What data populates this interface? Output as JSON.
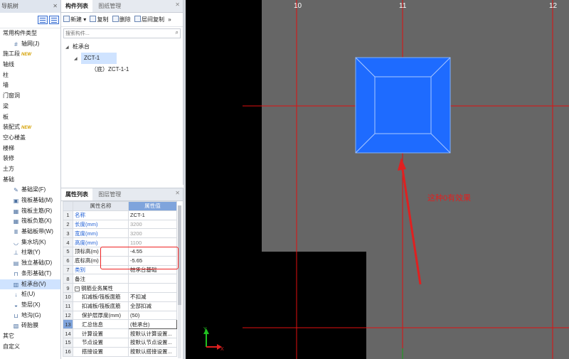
{
  "nav": {
    "title": "导航树",
    "items": [
      {
        "label": "常用构件类型",
        "type": "top"
      },
      {
        "label": "轴网(J)",
        "type": "sub",
        "icon": "grid-icon"
      },
      {
        "label": "施工段",
        "type": "top",
        "badge": "NEW"
      },
      {
        "label": "轴线",
        "type": "top"
      },
      {
        "label": "柱",
        "type": "top"
      },
      {
        "label": "墙",
        "type": "top"
      },
      {
        "label": "门窗洞",
        "type": "top"
      },
      {
        "label": "梁",
        "type": "top"
      },
      {
        "label": "板",
        "type": "top"
      },
      {
        "label": "装配式",
        "type": "top",
        "badge": "NEW"
      },
      {
        "label": "空心楼盖",
        "type": "top"
      },
      {
        "label": "楼梯",
        "type": "top"
      },
      {
        "label": "装修",
        "type": "top"
      },
      {
        "label": "土方",
        "type": "top"
      },
      {
        "label": "基础",
        "type": "top"
      },
      {
        "label": "基础梁(F)",
        "type": "sub",
        "icon": "pencil-icon"
      },
      {
        "label": "筏板基础(M)",
        "type": "sub",
        "icon": "slab-icon"
      },
      {
        "label": "筏板主筋(R)",
        "type": "sub",
        "icon": "rebar-icon"
      },
      {
        "label": "筏板负筋(X)",
        "type": "sub",
        "icon": "rebar-icon"
      },
      {
        "label": "基础板带(W)",
        "type": "sub",
        "icon": "strip-icon"
      },
      {
        "label": "集水坑(K)",
        "type": "sub",
        "icon": "pit-icon"
      },
      {
        "label": "柱墩(Y)",
        "type": "sub",
        "icon": "pier-icon"
      },
      {
        "label": "独立基础(D)",
        "type": "sub",
        "icon": "footing-icon"
      },
      {
        "label": "条形基础(T)",
        "type": "sub",
        "icon": "strip-footing-icon"
      },
      {
        "label": "桩承台(V)",
        "type": "sub",
        "icon": "pile-cap-icon",
        "selected": true
      },
      {
        "label": "桩(U)",
        "type": "sub",
        "icon": "pile-icon"
      },
      {
        "label": "垫层(X)",
        "type": "sub",
        "icon": "cushion-icon"
      },
      {
        "label": "地沟(G)",
        "type": "sub",
        "icon": "trench-icon"
      },
      {
        "label": "砖胎膜",
        "type": "sub",
        "icon": "brick-icon"
      },
      {
        "label": "其它",
        "type": "top"
      },
      {
        "label": "自定义",
        "type": "top"
      }
    ]
  },
  "comp_panel": {
    "tabs": [
      "构件列表",
      "图纸管理"
    ],
    "toolbar": {
      "new": "新建",
      "copy": "复制",
      "delete": "删除",
      "floor_copy": "层间复制"
    },
    "search_placeholder": "搜索构件...",
    "tree": {
      "root": "桩承台",
      "child": "ZCT-1",
      "leaf": "（底）ZCT-1-1"
    }
  },
  "prop_panel": {
    "tabs": [
      "属性列表",
      "图层管理"
    ],
    "headers": {
      "name": "属性名称",
      "value": "属性值"
    },
    "rows": [
      {
        "n": "1",
        "name": "名称",
        "value": "ZCT-1",
        "style": "blue"
      },
      {
        "n": "2",
        "name": "长度(mm)",
        "value": "3200",
        "style": "blue-gray"
      },
      {
        "n": "3",
        "name": "宽度(mm)",
        "value": "3200",
        "style": "blue-gray"
      },
      {
        "n": "4",
        "name": "高度(mm)",
        "value": "1100",
        "style": "blue-gray"
      },
      {
        "n": "5",
        "name": "顶标高(m)",
        "value": "-4.55",
        "style": ""
      },
      {
        "n": "6",
        "name": "底标高(m)",
        "value": "-5.65",
        "style": ""
      },
      {
        "n": "7",
        "name": "类别",
        "value": "桩承台基础",
        "style": "blue"
      },
      {
        "n": "8",
        "name": "备注",
        "value": "",
        "style": ""
      },
      {
        "n": "9",
        "name": "钢筋业务属性",
        "value": "",
        "style": "group"
      },
      {
        "n": "10",
        "name": "扣减板/筏板面筋",
        "value": "不扣减",
        "style": "indent"
      },
      {
        "n": "11",
        "name": "扣减板/筏板底筋",
        "value": "全部扣减",
        "style": "indent"
      },
      {
        "n": "12",
        "name": "保护层厚度(mm)",
        "value": "(50)",
        "style": "indent"
      },
      {
        "n": "13",
        "name": "汇总信息",
        "value": "(桩承台)",
        "style": "indent-hl"
      },
      {
        "n": "14",
        "name": "计算设置",
        "value": "按默认计算设置...",
        "style": "indent"
      },
      {
        "n": "15",
        "name": "节点设置",
        "value": "按默认节点设置...",
        "style": "indent"
      },
      {
        "n": "16",
        "name": "搭接设置",
        "value": "按默认搭接设置...",
        "style": "indent"
      }
    ]
  },
  "canvas": {
    "axis_labels": [
      "10",
      "11",
      "12"
    ],
    "annotation": "这种0有效果",
    "colors": {
      "bg": "#000000",
      "gray": "#666666",
      "pile_cap": "#1e6bff",
      "grid": "#e01010"
    }
  }
}
